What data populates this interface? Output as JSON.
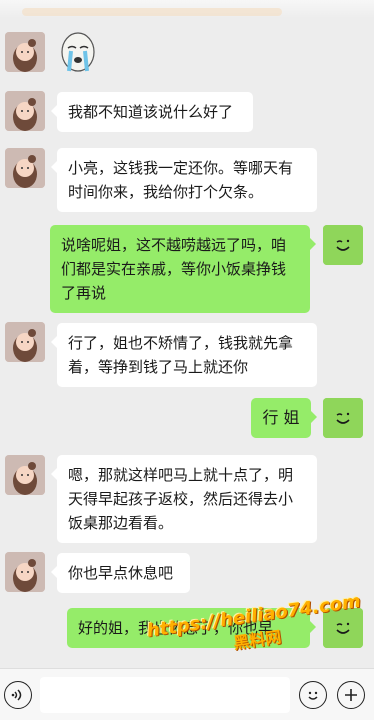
{
  "messages": [
    {
      "side": "left",
      "type": "sticker",
      "sticker": "crying-emoji-sticker"
    },
    {
      "side": "left",
      "type": "text",
      "lines": [
        "我都不知道该说什么好了"
      ]
    },
    {
      "side": "left",
      "type": "text",
      "lines": [
        "小亮，这钱我一定还你。等哪天有",
        "时间你来，我给你打个欠条。"
      ]
    },
    {
      "side": "right",
      "type": "text",
      "lines": [
        "说啥呢姐，这不越唠越远了吗，咱",
        "们都是实在亲戚，等你小饭桌挣钱",
        "了再说"
      ]
    },
    {
      "side": "left",
      "type": "text",
      "lines": [
        "行了，姐也不矫情了，钱我就先拿",
        "着，等挣到钱了马上就还你"
      ]
    },
    {
      "side": "right",
      "type": "text",
      "lines": [
        "行 姐"
      ]
    },
    {
      "side": "left",
      "type": "text",
      "lines": [
        "嗯，那就这样吧马上就十点了，明",
        "天得早起孩子返校，然后还得去小",
        "饭桌那边看看。"
      ]
    },
    {
      "side": "left",
      "type": "text",
      "lines": [
        "你也早点休息吧"
      ]
    },
    {
      "side": "right",
      "type": "text",
      "lines": [
        "好的姐，我也休息了，你也早"
      ]
    }
  ],
  "watermark": {
    "url": "https://heiliao74.com",
    "name": "黑料网"
  },
  "input_bar": {
    "voice_icon": "voice-icon",
    "emoji_icon": "emoji-icon",
    "plus_icon": "plus-icon"
  },
  "colors": {
    "background": "#ededed",
    "left_bubble": "#ffffff",
    "right_bubble": "#95ec69",
    "watermark": "#ffb000"
  }
}
